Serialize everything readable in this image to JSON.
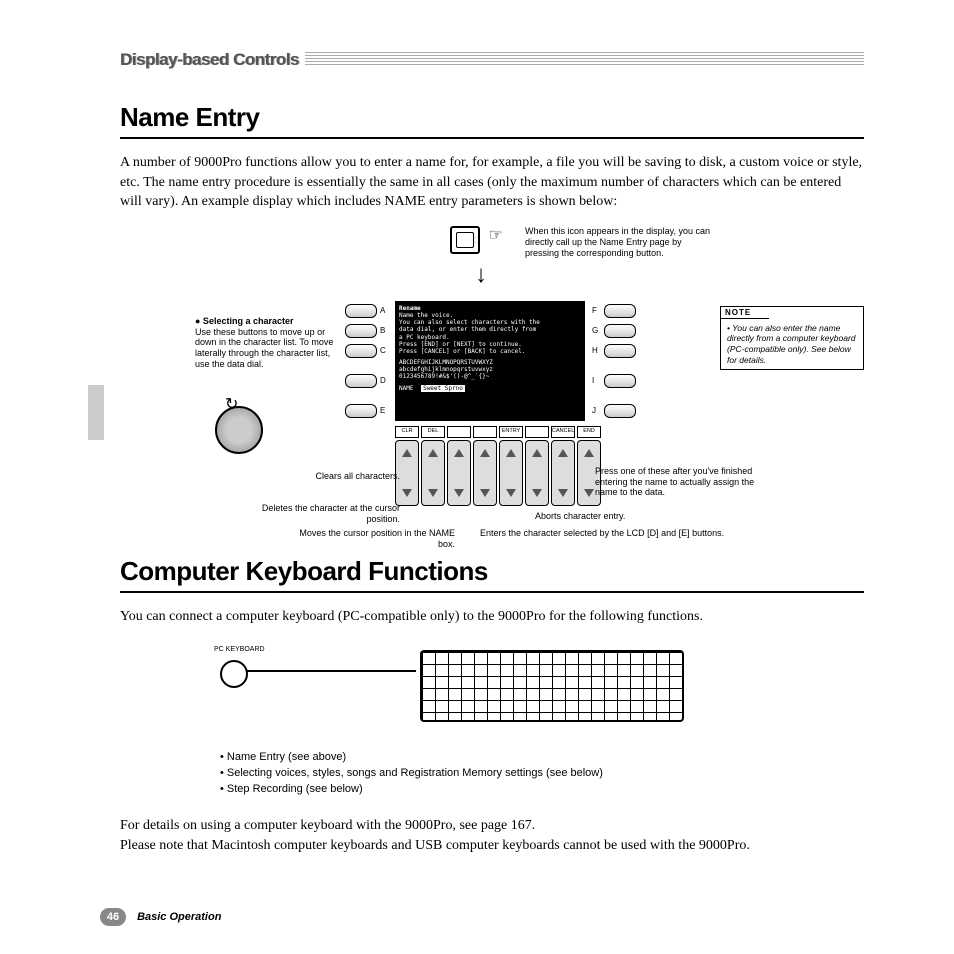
{
  "header": {
    "title": "Display-based Controls"
  },
  "section1": {
    "heading": "Name Entry",
    "intro": "A number of 9000Pro functions allow you to enter a name for, for example, a file you will be saving to disk, a custom voice or style, etc. The name entry procedure is essentially the same in all cases (only the maximum number of characters which can be entered will vary). An example display which includes NAME entry parameters is shown below:"
  },
  "figure": {
    "icon_text": "When this icon appears in the display, you can directly call up the Name Entry page by pressing the corresponding button.",
    "select_title": "● Selecting a character",
    "select_body": "Use these buttons to move up or down in the character list. To move laterally through the character list, use the data dial.",
    "left_labels": [
      "A",
      "B",
      "C",
      "D",
      "E"
    ],
    "right_labels": [
      "F",
      "G",
      "H",
      "I",
      "J"
    ],
    "lcd": {
      "title": "Rename",
      "l1": "Name the voice.",
      "l2": "You can also select characters with the",
      "l3": "data dial, or enter them directly from",
      "l4": "a PC keyboard.",
      "l5": "Press [END] or [NEXT] to continue.",
      "l6": "Press [CANCEL] or [BACK] to cancel.",
      "row1": "ABCDEFGHIJKLMNOPQRSTUVWXYZ",
      "row2": "abcdefghijklmnopqrstuvwxyz",
      "row3": "0123456789!#&$'()-@^_`{}~",
      "name_label": "NAME",
      "name_value": "Sweet Sprno"
    },
    "btns": [
      "CLR",
      "DEL",
      "",
      "",
      "ENTRY",
      "",
      "CANCEL",
      "END"
    ],
    "c_clear": "Clears all characters.",
    "c_delete": "Deletes the character at the cursor position.",
    "c_move": "Moves the cursor position in the NAME box.",
    "c_entry": "Enters the character selected by the LCD [D] and [E] buttons.",
    "c_cancel": "Aborts character entry.",
    "c_end": "Press one of these after you've finished entering the name to actually assign the name to the data.",
    "note_head": "NOTE",
    "note_body": "You can also enter the name directly from a computer keyboard (PC-compatible only). See below for details."
  },
  "section2": {
    "heading": "Computer Keyboard Functions",
    "intro": "You can connect a computer keyboard (PC-compatible only) to the 9000Pro for the following functions.",
    "port_label": "PC KEYBOARD",
    "bullets": [
      "• Name Entry (see above)",
      "• Selecting voices, styles, songs and Registration Memory settings (see below)",
      "• Step Recording (see below)"
    ],
    "outro1": "For details on using a computer keyboard with the 9000Pro, see page 167.",
    "outro2": "Please note that Macintosh computer keyboards and USB computer keyboards cannot be used with the 9000Pro."
  },
  "footer": {
    "page": "46",
    "section": "Basic Operation"
  }
}
